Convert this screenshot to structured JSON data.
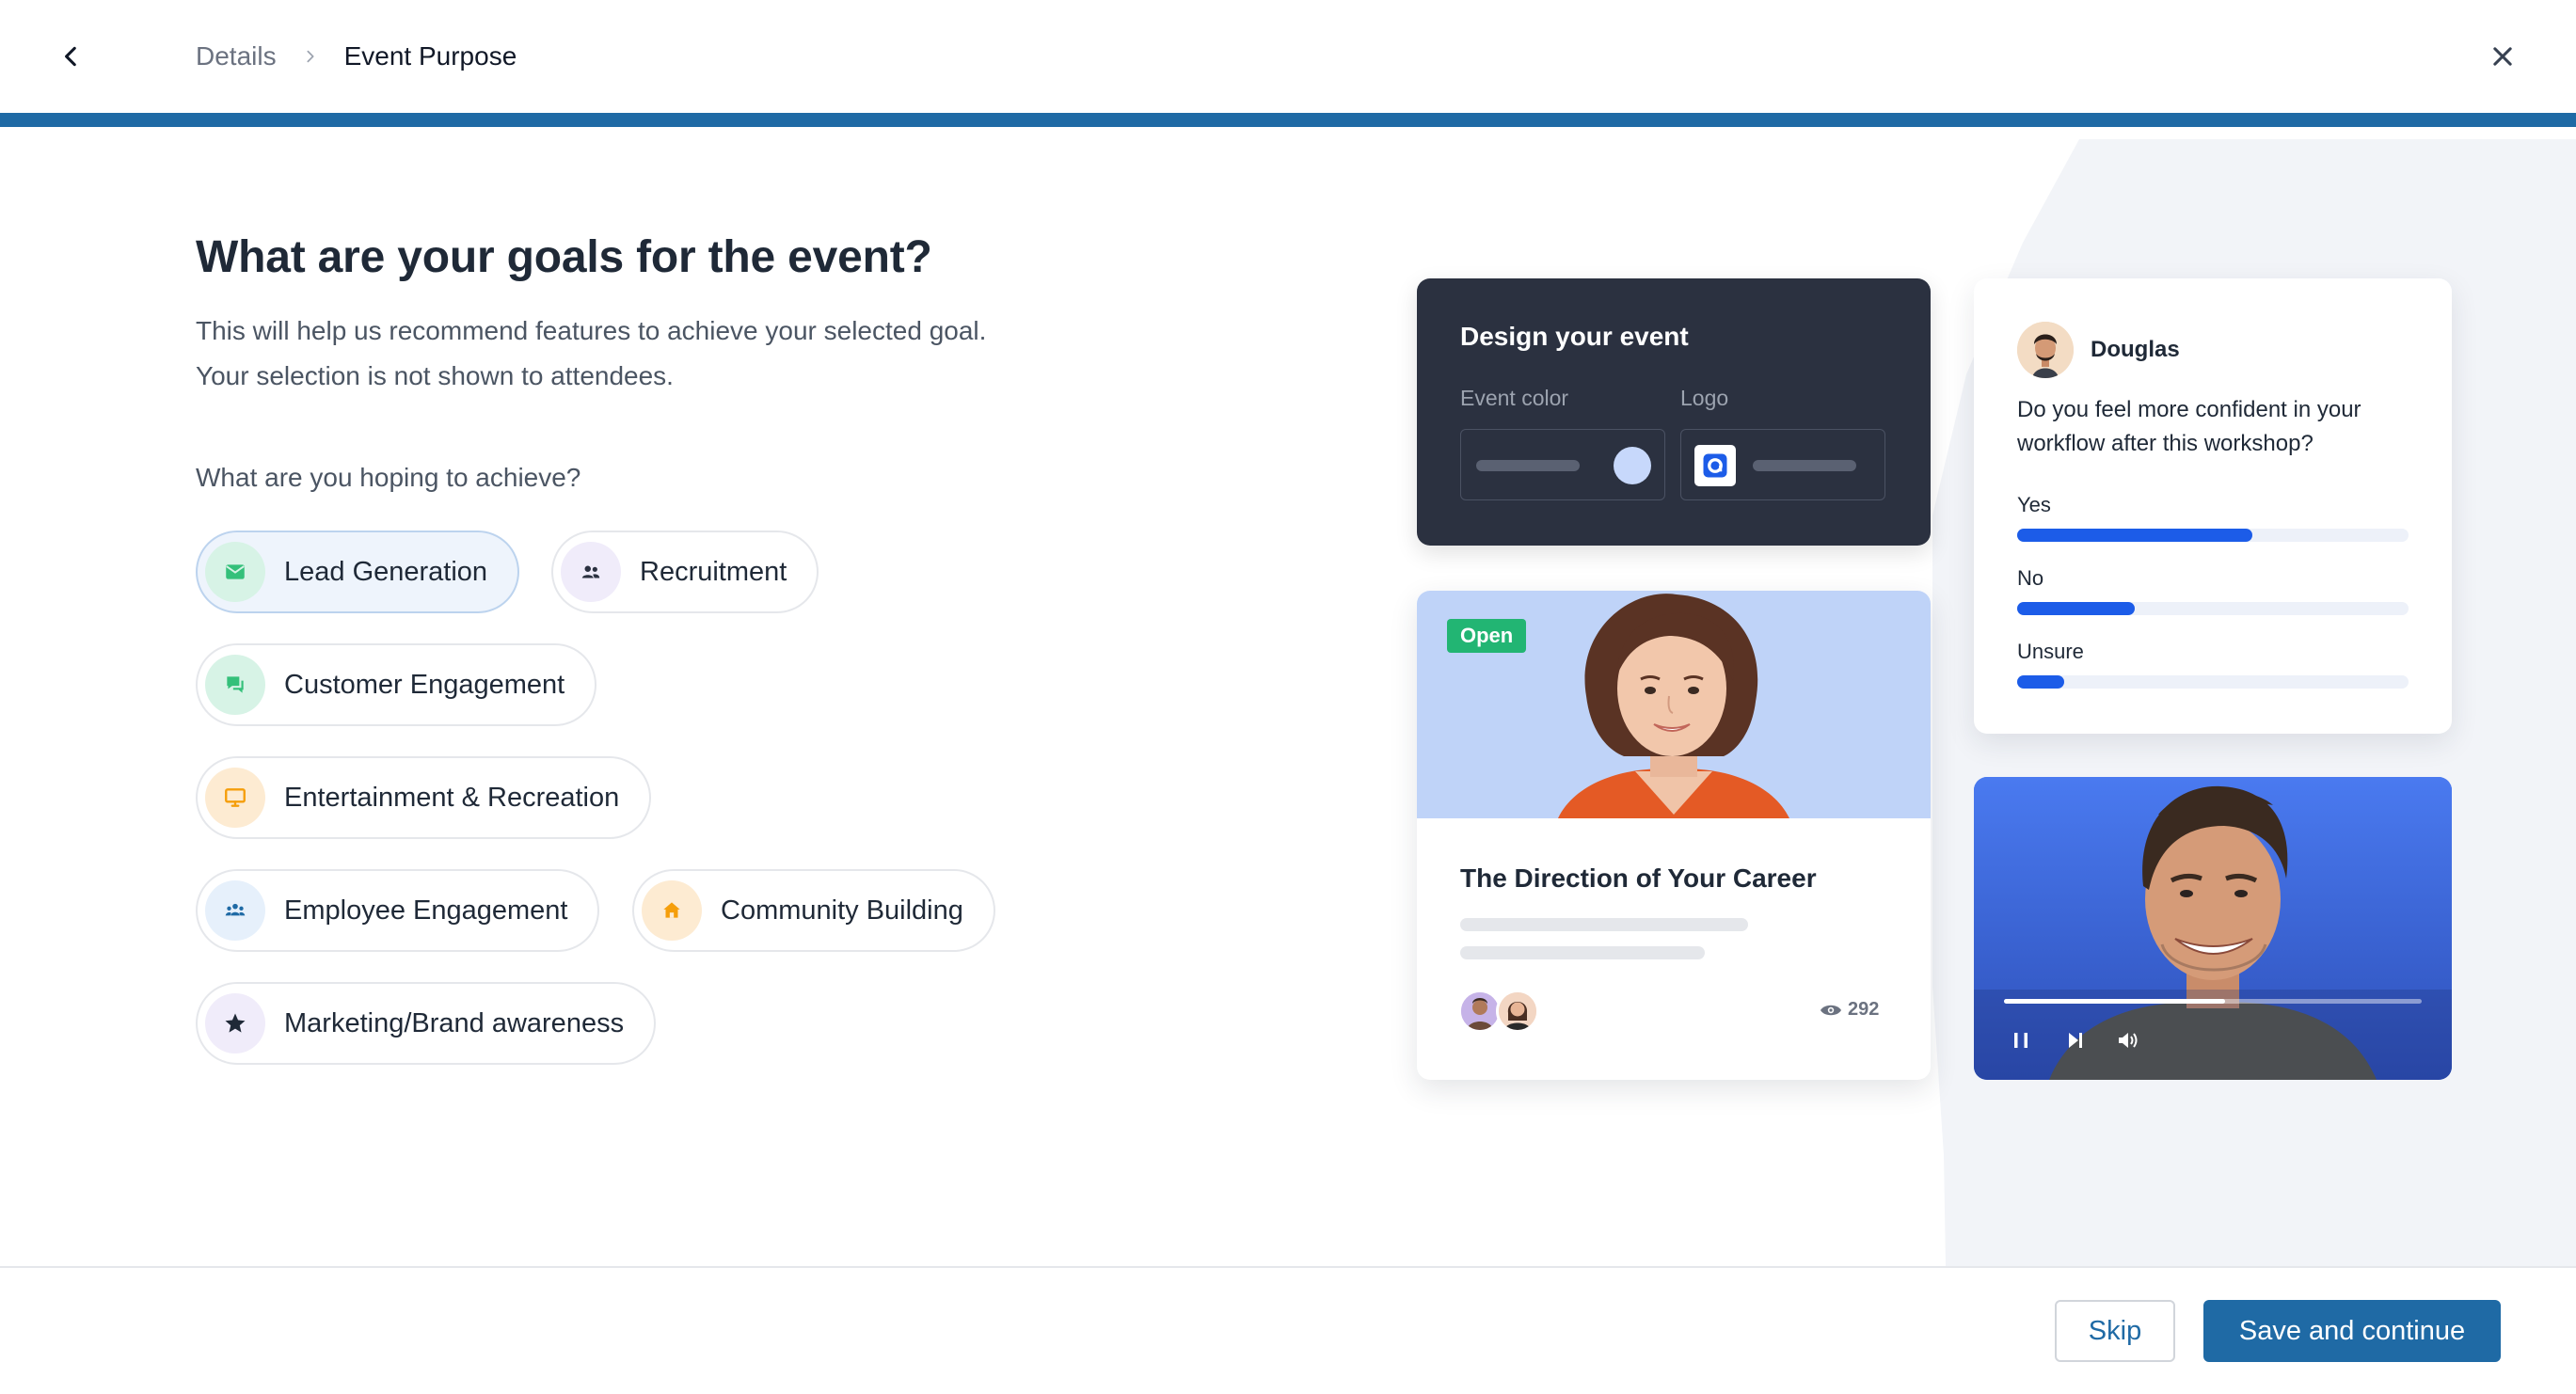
{
  "header": {
    "back_icon": "chevron-left-icon",
    "breadcrumb": [
      "Details",
      "Event Purpose"
    ],
    "close_icon": "close-icon"
  },
  "main": {
    "title": "What are your goals for the event?",
    "subtitle_line1": "This will help us recommend features to achieve your selected goal.",
    "subtitle_line2": "Your selection is not shown to attendees.",
    "question": "What are you hoping to achieve?",
    "goals": [
      {
        "label": "Lead Generation",
        "icon": "mail-icon",
        "selected": true
      },
      {
        "label": "Recruitment",
        "icon": "people-icon",
        "selected": false
      },
      {
        "label": "Customer Engagement",
        "icon": "chat-icon",
        "selected": false
      },
      {
        "label": "Entertainment & Recreation",
        "icon": "monitor-icon",
        "selected": false
      },
      {
        "label": "Employee Engagement",
        "icon": "team-icon",
        "selected": false
      },
      {
        "label": "Community Building",
        "icon": "home-icon",
        "selected": false
      },
      {
        "label": "Marketing/Brand awareness",
        "icon": "star-icon",
        "selected": false
      }
    ]
  },
  "preview": {
    "design_card": {
      "title": "Design your event",
      "event_color_label": "Event color",
      "logo_label": "Logo"
    },
    "session_card": {
      "badge": "Open",
      "title": "The Direction of Your Career",
      "views": "292"
    },
    "poll_card": {
      "author": "Douglas",
      "question": "Do you feel more confident in your workflow after this workshop?",
      "options": [
        {
          "label": "Yes",
          "fraction": 0.6
        },
        {
          "label": "No",
          "fraction": 0.3
        },
        {
          "label": "Unsure",
          "fraction": 0.12
        }
      ]
    },
    "video_card": {
      "progress_fraction": 0.53
    }
  },
  "footer": {
    "skip_label": "Skip",
    "save_label": "Save and continue"
  },
  "colors": {
    "primary": "#1f6aa5",
    "selected_bg": "#eef4fc",
    "dark_card": "#2b3140",
    "poll_fill": "#1c5ce8",
    "open_badge": "#22b573"
  }
}
